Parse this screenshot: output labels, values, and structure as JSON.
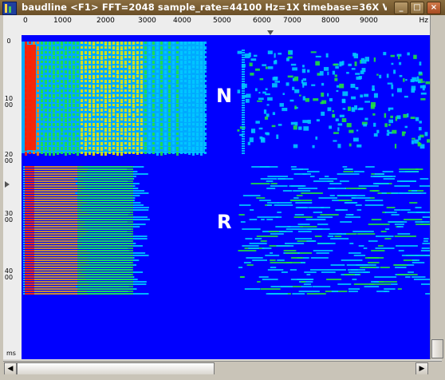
{
  "window": {
    "title": "baudline  <F1> FFT=2048 sample_rate=44100 Hz=1X timebase=36X  V",
    "buttons": {
      "minimize": "_",
      "maximize": "□",
      "close": "×"
    }
  },
  "frequency_axis": {
    "ticks": [
      "0",
      "1000",
      "2000",
      "3000",
      "4000",
      "5000",
      "6000",
      "7000",
      "8000",
      "9000"
    ],
    "unit": "Hz"
  },
  "time_axis": {
    "ticks": [
      "0",
      "1000",
      "2000",
      "3000",
      "4000"
    ],
    "corner_unit": "ms"
  },
  "labels": {
    "top_region": "N",
    "bottom_region": "R"
  },
  "colors": {
    "background_blue": "#0000ff",
    "cyan": "#00c8ff",
    "green": "#20e040",
    "yellow": "#e8e800",
    "orange": "#ff8000",
    "red": "#ff2000"
  },
  "scroll": {
    "left_arrow": "◀",
    "right_arrow": "▶"
  }
}
